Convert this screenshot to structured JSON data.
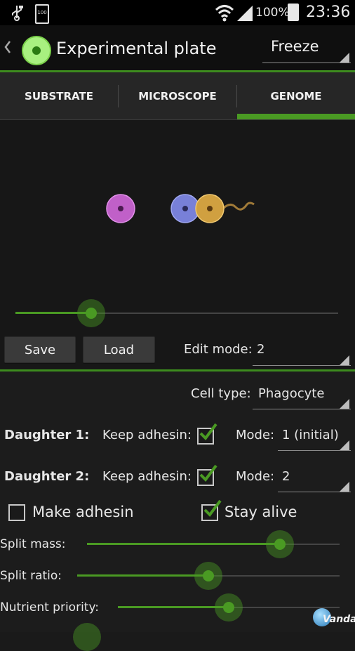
{
  "status_bar": {
    "battery_percent_text": "100%",
    "time": "23:36",
    "left_badge": "100"
  },
  "action_bar": {
    "title": "Experimental plate",
    "spinner_value": "Freeze"
  },
  "tabs": [
    {
      "label": "SUBSTRATE",
      "selected": false
    },
    {
      "label": "MICROSCOPE",
      "selected": false
    },
    {
      "label": "GENOME",
      "selected": true
    }
  ],
  "preview_slider_level": 0.23,
  "buttons": {
    "save": "Save",
    "load": "Load"
  },
  "edit_mode": {
    "label": "Edit mode:",
    "value": "2"
  },
  "cell_type": {
    "label": "Cell type:",
    "value": "Phagocyte"
  },
  "daughter1": {
    "label": "Daughter 1:",
    "keep_adhesin_label": "Keep adhesin:",
    "keep_adhesin_checked": true,
    "mode_label": "Mode:",
    "mode_value": "1 (initial)"
  },
  "daughter2": {
    "label": "Daughter 2:",
    "keep_adhesin_label": "Keep adhesin:",
    "keep_adhesin_checked": true,
    "mode_label": "Mode:",
    "mode_value": "2"
  },
  "make_adhesin": {
    "label": "Make adhesin",
    "checked": false
  },
  "stay_alive": {
    "label": "Stay alive",
    "checked": true
  },
  "sliders": [
    {
      "label": "Split mass:",
      "level": 0.77
    },
    {
      "label": "Split ratio:",
      "level": 0.5
    },
    {
      "label": "Nutrient priority:",
      "level": 0.5
    }
  ],
  "watermark": "Vandal",
  "colors": {
    "accent": "#4a9a23",
    "cell_pink": "#c060c8",
    "cell_blue": "#7880d8",
    "cell_gold": "#d0a040"
  }
}
